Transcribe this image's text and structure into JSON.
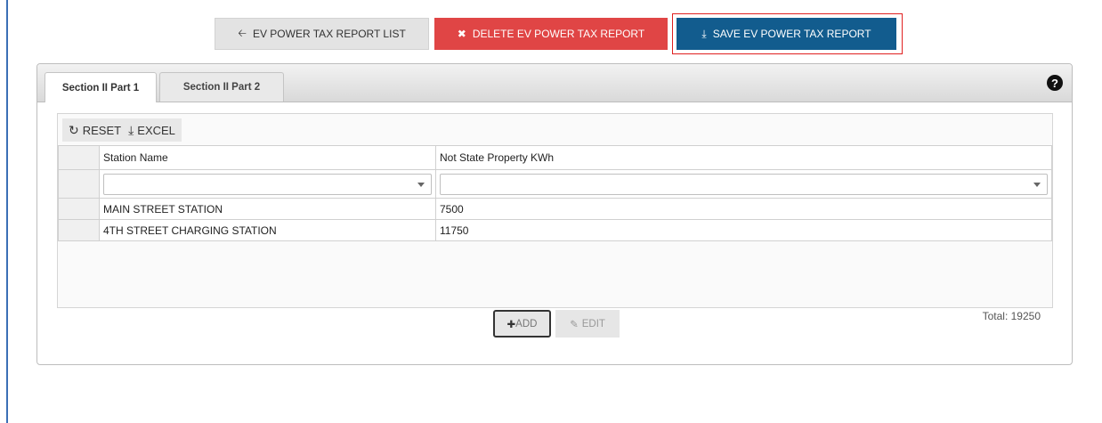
{
  "toolbar": {
    "list_label": "EV POWER TAX REPORT LIST",
    "delete_label": "DELETE EV POWER TAX REPORT",
    "save_label": "SAVE EV POWER TAX REPORT"
  },
  "tabs": [
    {
      "label": "Section II Part 1",
      "active": true
    },
    {
      "label": "Section II Part 2",
      "active": false
    }
  ],
  "grid": {
    "tools": {
      "reset": "RESET",
      "excel": "EXCEL"
    },
    "columns": [
      "Station Name",
      "Not State Property KWh"
    ],
    "rows": [
      [
        "MAIN STREET STATION",
        "7500"
      ],
      [
        "4TH STREET CHARGING STATION",
        "11750"
      ]
    ]
  },
  "footer": {
    "add_label": "ADD",
    "edit_label": "EDIT",
    "total_text": "Total: 19250"
  },
  "colors": {
    "delete": "#e04545",
    "save": "#125c8e",
    "highlight": "#e02020"
  }
}
